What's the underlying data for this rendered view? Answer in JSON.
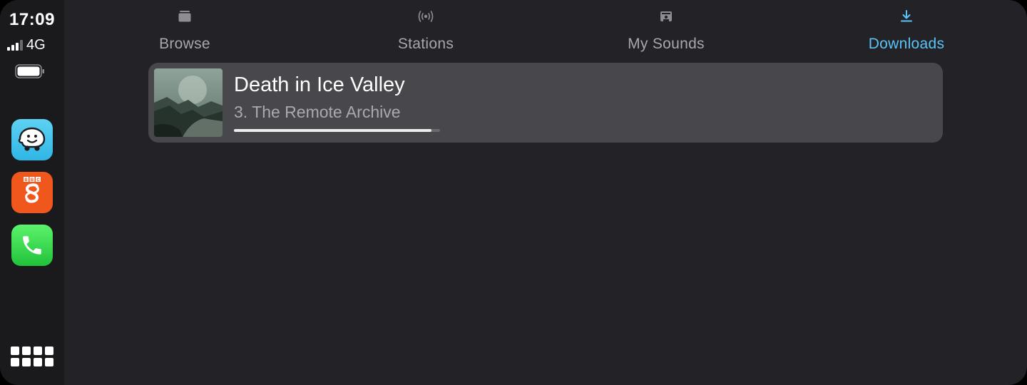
{
  "status": {
    "time": "17:09",
    "network": "4G",
    "signal_bars_active": 3,
    "signal_bars_total": 4
  },
  "dock": {
    "apps": [
      {
        "name": "Waze",
        "icon": "waze-icon",
        "color": "#33BCE8"
      },
      {
        "name": "BBC Sounds",
        "icon": "bbc-sounds-icon",
        "color": "#F0571C",
        "badge_text": "BBC"
      },
      {
        "name": "Phone",
        "icon": "phone-icon",
        "color": "#2BCB46"
      }
    ],
    "app_grid_icon": "app-grid-icon"
  },
  "tabs": [
    {
      "label": "Browse",
      "icon": "browse-icon",
      "active": false
    },
    {
      "label": "Stations",
      "icon": "stations-icon",
      "active": false
    },
    {
      "label": "My Sounds",
      "icon": "my-sounds-icon",
      "active": false
    },
    {
      "label": "Downloads",
      "icon": "download-icon",
      "active": true
    }
  ],
  "downloads": [
    {
      "title": "Death in Ice Valley",
      "subtitle": "3. The Remote Archive",
      "progress": 0.96,
      "artwork": "misty-valley-artwork"
    }
  ],
  "colors": {
    "accent": "#5AC3F8",
    "background": "#232327",
    "sidebar": "#1A1A1C",
    "card": "#48484C"
  }
}
